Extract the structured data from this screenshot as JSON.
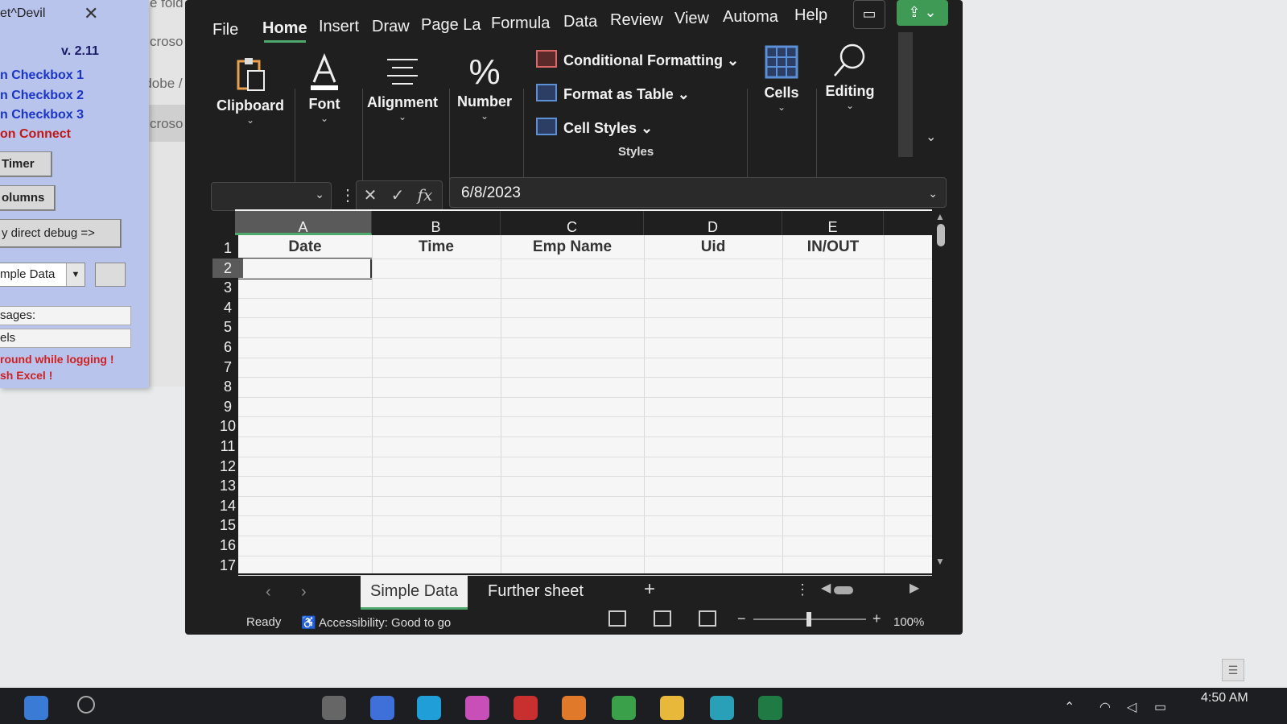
{
  "left_panel": {
    "title": "et^Devil",
    "close": "✕",
    "version": "v. 2.11",
    "links": [
      "n Checkbox 1",
      "n Checkbox 2",
      "n Checkbox 3"
    ],
    "connect": "on Connect",
    "timer_button": "Timer",
    "columns_button": "olumns",
    "debug_button": "y direct debug =>",
    "sheet_combo": "mple Data",
    "messages_label": "sages:",
    "field2": "els",
    "error_line1": "round while logging !",
    "error_line2": "sh Excel !"
  },
  "background_menu": {
    "items": [
      "File fold",
      "Microso",
      "Adobe /",
      "Microso"
    ]
  },
  "excel": {
    "menu_tabs": [
      "File",
      "Home",
      "Insert",
      "Draw",
      "Page La",
      "Formula",
      "Data",
      "Review",
      "View",
      "Automa",
      "Help"
    ],
    "active_tab": "Home",
    "ribbon": {
      "clipboard": "Clipboard",
      "font": "Font",
      "alignment": "Alignment",
      "number": "Number",
      "conditional_formatting": "Conditional Formatting",
      "format_as_table": "Format as Table",
      "cell_styles": "Cell Styles",
      "styles": "Styles",
      "cells": "Cells",
      "editing": "Editing"
    },
    "formula_bar": {
      "name_box": "",
      "cancel": "✕",
      "enter": "✓",
      "fx": "fx",
      "value": "6/8/2023"
    },
    "columns": [
      "A",
      "B",
      "C",
      "D",
      "E"
    ],
    "header_row": [
      "Date",
      "Time",
      "Emp Name",
      "Uid",
      "IN/OUT"
    ],
    "rows": [
      "1",
      "2",
      "3",
      "4",
      "5",
      "6",
      "7",
      "8",
      "9",
      "10",
      "11",
      "12",
      "13",
      "14",
      "15",
      "16",
      "17"
    ],
    "active_cell": "A2",
    "sheets": [
      "Simple Data",
      "Further sheet"
    ],
    "active_sheet": "Simple Data",
    "status": {
      "ready": "Ready",
      "accessibility": "Accessibility: Good to go",
      "zoom": "100%"
    }
  },
  "taskbar": {
    "time": "4:50 AM"
  },
  "colors": {
    "excel_dark": "#1f1f1f",
    "accent_green": "#4fa86c",
    "panel_blue": "#b8c4ec",
    "link_blue": "#1b34c8",
    "error_red": "#d02020"
  }
}
